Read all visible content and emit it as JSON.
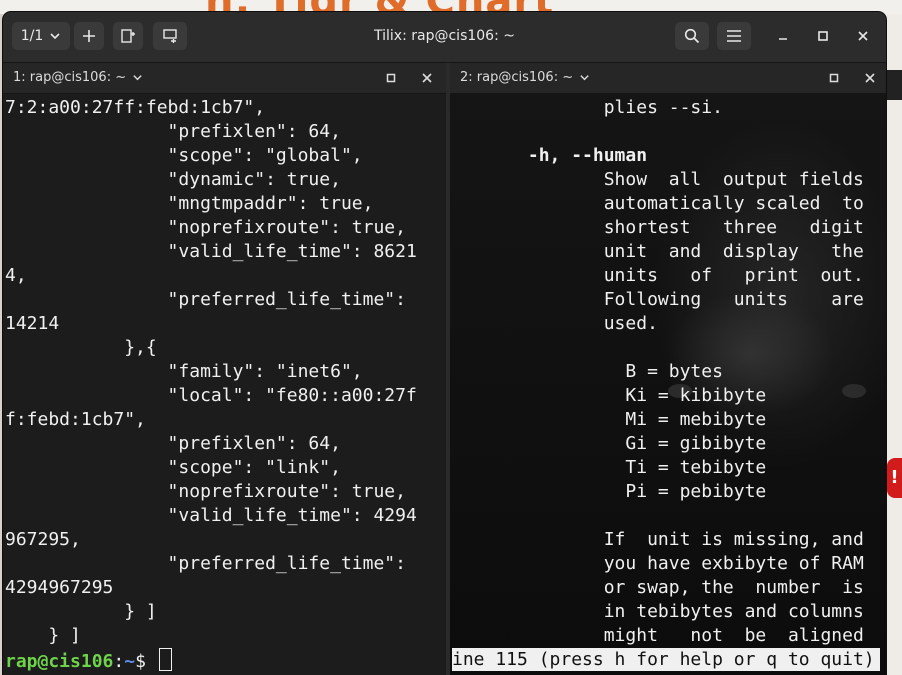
{
  "window": {
    "title": "Tilix: rap@cis106: ~",
    "session_counter": "1/1"
  },
  "panes": {
    "left": {
      "title": "1: rap@cis106: ~",
      "lines": [
        "7:2:a00:27ff:febd:1cb7\",",
        "               \"prefixlen\": 64,",
        "               \"scope\": \"global\",",
        "               \"dynamic\": true,",
        "               \"mngtmpaddr\": true,",
        "               \"noprefixroute\": true,",
        "               \"valid_life_time\": 8621",
        "4,",
        "               \"preferred_life_time\":",
        "14214",
        "           },{",
        "               \"family\": \"inet6\",",
        "               \"local\": \"fe80::a00:27f",
        "f:febd:1cb7\",",
        "               \"prefixlen\": 64,",
        "               \"scope\": \"link\",",
        "               \"noprefixroute\": true,",
        "               \"valid_life_time\": 4294",
        "967295,",
        "               \"preferred_life_time\":",
        "4294967295",
        "           } ]",
        "    } ]"
      ],
      "prompt_user": "rap@cis106",
      "prompt_sep": ":",
      "prompt_path": "~",
      "prompt_symbol": "$ "
    },
    "right": {
      "title": "2: rap@cis106: ~",
      "lines": [
        "              plies --si.",
        "",
        "       -h, --human",
        "              Show  all  output fields",
        "              automatically scaled  to",
        "              shortest   three   digit",
        "              unit  and  display   the",
        "              units   of   print  out.",
        "              Following   units    are",
        "              used.",
        "",
        "                B = bytes",
        "                Ki = kibibyte",
        "                Mi = mebibyte",
        "                Gi = gibibyte",
        "                Ti = tebibyte",
        "                Pi = pebibyte",
        "",
        "              If  unit is missing, and",
        "              you have exbibyte of RAM",
        "              or swap, the  number  is",
        "              in tebibytes and columns",
        "              might   not  be  aligned"
      ],
      "status": "ine 115 (press h for help or q to quit)"
    }
  }
}
